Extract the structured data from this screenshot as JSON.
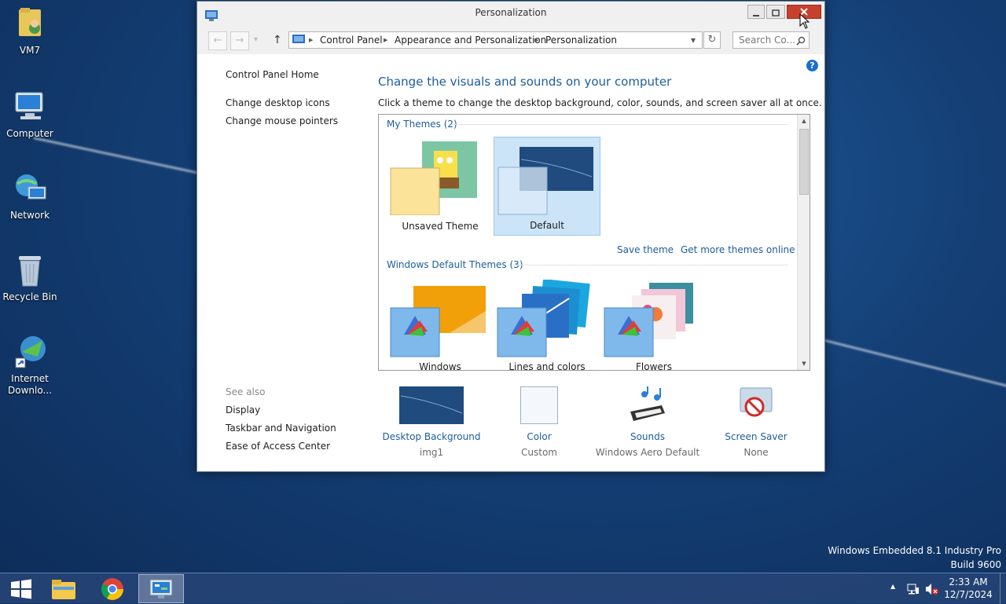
{
  "desktop": {
    "icons": [
      {
        "label": "VM7"
      },
      {
        "label": "Computer"
      },
      {
        "label": "Network"
      },
      {
        "label": "Recycle Bin"
      },
      {
        "label": "Internet Downlo..."
      }
    ],
    "watermark": {
      "line1": "Windows Embedded 8.1 Industry Pro",
      "line2": "Build 9600"
    }
  },
  "window": {
    "title": "Personalization",
    "address": {
      "sep": "▶",
      "crumbs": [
        "Control Panel",
        "Appearance and Personalization",
        "Personalization"
      ],
      "dropdown": "▾",
      "refresh": "↻"
    },
    "search_placeholder": "Search Co...",
    "help": "?",
    "nav": {
      "back": "←",
      "forward": "→",
      "recent": "▾",
      "up": "↑"
    }
  },
  "left_panel": {
    "home": "Control Panel Home",
    "links": [
      "Change desktop icons",
      "Change mouse pointers"
    ],
    "see_also_label": "See also",
    "see_also": [
      "Display",
      "Taskbar and Navigation",
      "Ease of Access Center"
    ]
  },
  "main": {
    "heading": "Change the visuals and sounds on your computer",
    "subtext": "Click a theme to change the desktop background, color, sounds, and screen saver all at once.",
    "my_themes": {
      "header": "My Themes (2)",
      "items": [
        {
          "name": "Unsaved Theme",
          "selected": false
        },
        {
          "name": "Default",
          "selected": true
        }
      ]
    },
    "save_theme": "Save theme",
    "get_more": "Get more themes online",
    "default_themes": {
      "header": "Windows Default Themes (3)",
      "items": [
        {
          "name": "Windows"
        },
        {
          "name": "Lines and colors"
        },
        {
          "name": "Flowers"
        }
      ]
    },
    "bottom": [
      {
        "label": "Desktop Background",
        "value": "img1"
      },
      {
        "label": "Color",
        "value": "Custom"
      },
      {
        "label": "Sounds",
        "value": "Windows Aero Default"
      },
      {
        "label": "Screen Saver",
        "value": "None"
      }
    ]
  },
  "taskbar": {
    "clock_time": "2:33 AM",
    "clock_date": "12/7/2024",
    "tray_chevron": "▲"
  }
}
